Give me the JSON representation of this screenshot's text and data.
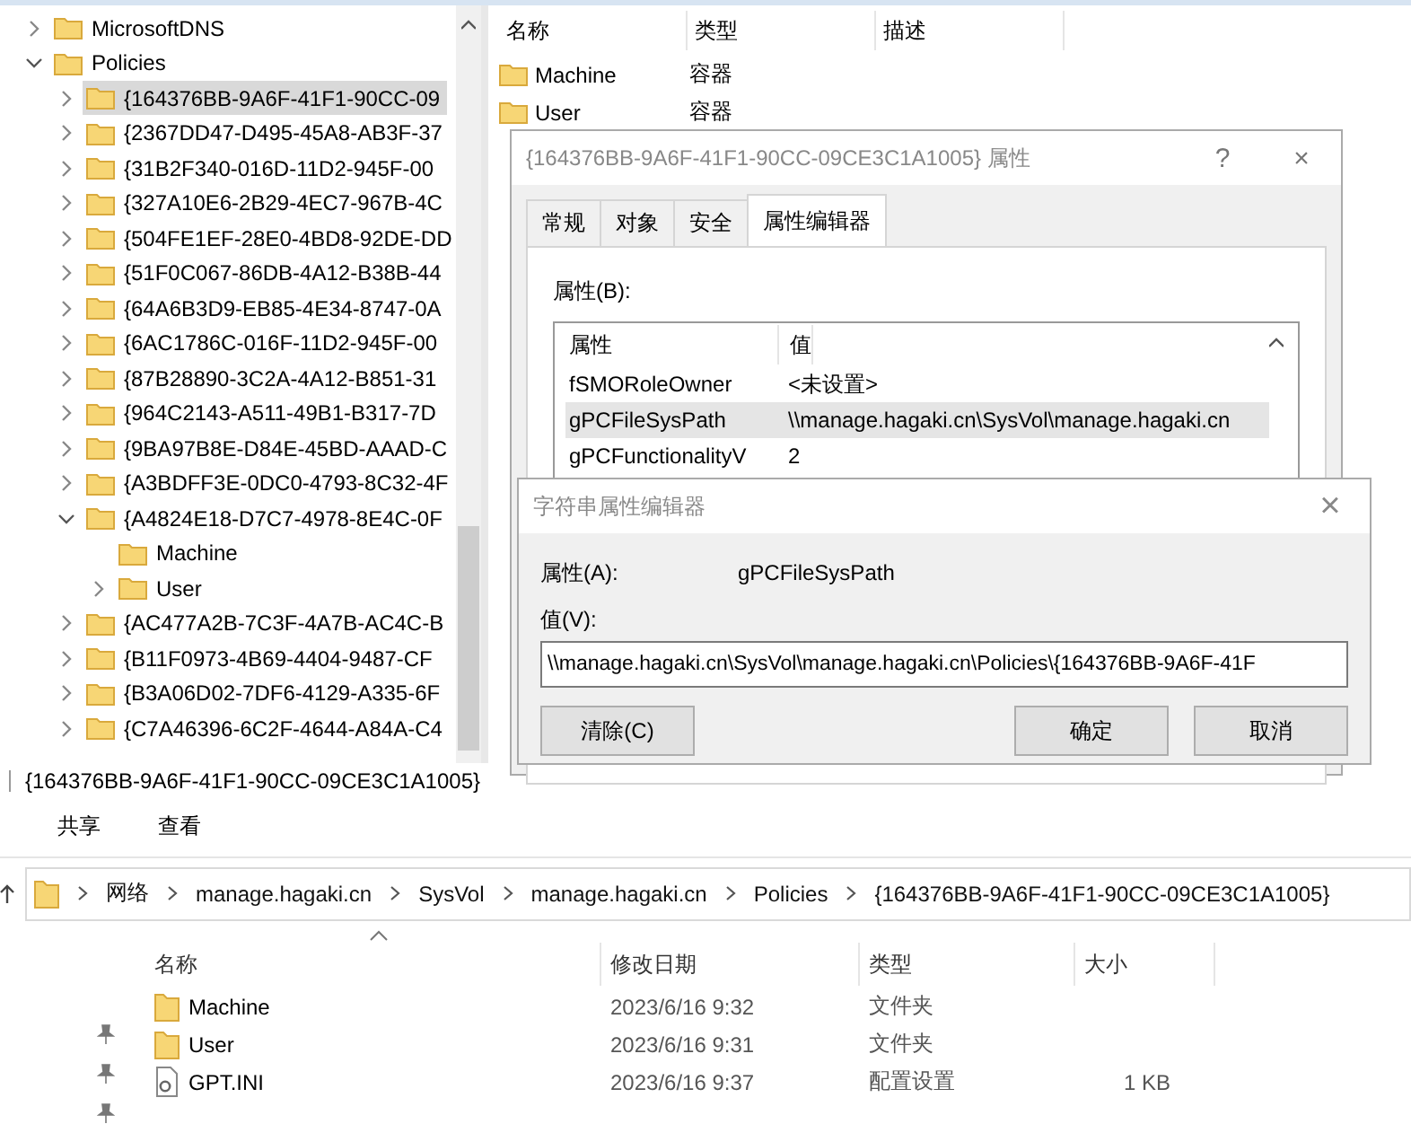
{
  "adsi": {
    "tree": [
      {
        "label": "MicrosoftDNS",
        "expanded": false,
        "selected": false
      },
      {
        "label": "Policies",
        "expanded": true,
        "selected": false,
        "children": [
          {
            "label": "{164376BB-9A6F-41F1-90CC-09",
            "expanded": false,
            "selected": true
          },
          {
            "label": "{2367DD47-D495-45A8-AB3F-37",
            "expanded": false,
            "selected": false
          },
          {
            "label": "{31B2F340-016D-11D2-945F-00",
            "expanded": false,
            "selected": false
          },
          {
            "label": "{327A10E6-2B29-4EC7-967B-4C",
            "expanded": false,
            "selected": false
          },
          {
            "label": "{504FE1EF-28E0-4BD8-92DE-DD",
            "expanded": false,
            "selected": false
          },
          {
            "label": "{51F0C067-86DB-4A12-B38B-44",
            "expanded": false,
            "selected": false
          },
          {
            "label": "{64A6B3D9-EB85-4E34-8747-0A",
            "expanded": false,
            "selected": false
          },
          {
            "label": "{6AC1786C-016F-11D2-945F-00",
            "expanded": false,
            "selected": false
          },
          {
            "label": "{87B28890-3C2A-4A12-B851-31",
            "expanded": false,
            "selected": false
          },
          {
            "label": "{964C2143-A511-49B1-B317-7D",
            "expanded": false,
            "selected": false
          },
          {
            "label": "{9BA97B8E-D84E-45BD-AAAD-C",
            "expanded": false,
            "selected": false
          },
          {
            "label": "{A3BDFF3E-0DC0-4793-8C32-4F",
            "expanded": false,
            "selected": false
          },
          {
            "label": "{A4824E18-D7C7-4978-8E4C-0F",
            "expanded": true,
            "selected": false,
            "children": [
              {
                "label": "Machine",
                "selected": false
              },
              {
                "label": "User",
                "expanded": false,
                "selected": false
              }
            ]
          },
          {
            "label": "{AC477A2B-7C3F-4A7B-AC4C-B",
            "expanded": false,
            "selected": false
          },
          {
            "label": "{B11F0973-4B69-4404-9487-CF",
            "expanded": false,
            "selected": false
          },
          {
            "label": "{B3A06D02-7DF6-4129-A335-6F",
            "expanded": false,
            "selected": false
          },
          {
            "label": "{C7A46396-6C2F-4644-A84A-C4",
            "expanded": false,
            "selected": false
          }
        ]
      }
    ],
    "list": {
      "columns": [
        "名称",
        "类型",
        "描述"
      ],
      "rows": [
        {
          "name": "Machine",
          "type": "容器"
        },
        {
          "name": "User",
          "type": "容器"
        }
      ]
    }
  },
  "properties_dialog": {
    "title": "{164376BB-9A6F-41F1-90CC-09CE3C1A1005} 属性",
    "help": "?",
    "close": "×",
    "tabs": [
      {
        "label": "常规",
        "selected": false
      },
      {
        "label": "对象",
        "selected": false
      },
      {
        "label": "安全",
        "selected": false
      },
      {
        "label": "属性编辑器",
        "selected": true
      }
    ],
    "attributes_label": "属性(B):",
    "columns": [
      "属性",
      "值"
    ],
    "rows": [
      {
        "name": "fSMORoleOwner",
        "value": "<未设置>",
        "selected": false
      },
      {
        "name": "gPCFileSysPath",
        "value": "\\\\manage.hagaki.cn\\SysVol\\manage.hagaki.cn",
        "selected": true
      },
      {
        "name": "gPCFunctionalityV",
        "value": "2",
        "selected": false
      }
    ]
  },
  "string_editor": {
    "title": "字符串属性编辑器",
    "close": "×",
    "attribute_label": "属性(A):",
    "attribute": "gPCFileSysPath",
    "value_label": "值(V):",
    "value": "\\\\manage.hagaki.cn\\SysVol\\manage.hagaki.cn\\Policies\\{164376BB-9A6F-41F",
    "buttons": [
      "清除(C)",
      "确定",
      "取消"
    ]
  },
  "explorer": {
    "title": "{164376BB-9A6F-41F1-90CC-09CE3C1A1005}",
    "ribbon_tabs": [
      "共享",
      "查看"
    ],
    "breadcrumb": [
      "网络",
      "manage.hagaki.cn",
      "SysVol",
      "manage.hagaki.cn",
      "Policies",
      "{164376BB-9A6F-41F1-90CC-09CE3C1A1005}"
    ],
    "columns": [
      "名称",
      "修改日期",
      "类型",
      "大小"
    ],
    "rows": [
      {
        "kind": "folder",
        "name": "Machine",
        "modified": "2023/6/16 9:32",
        "type": "文件夹"
      },
      {
        "kind": "folder",
        "name": "User",
        "modified": "2023/6/16 9:31",
        "type": "文件夹"
      },
      {
        "kind": "file",
        "name": "GPT.INI",
        "modified": "2023/6/16 9:37",
        "type": "配置设置",
        "size": "1 KB"
      }
    ]
  }
}
